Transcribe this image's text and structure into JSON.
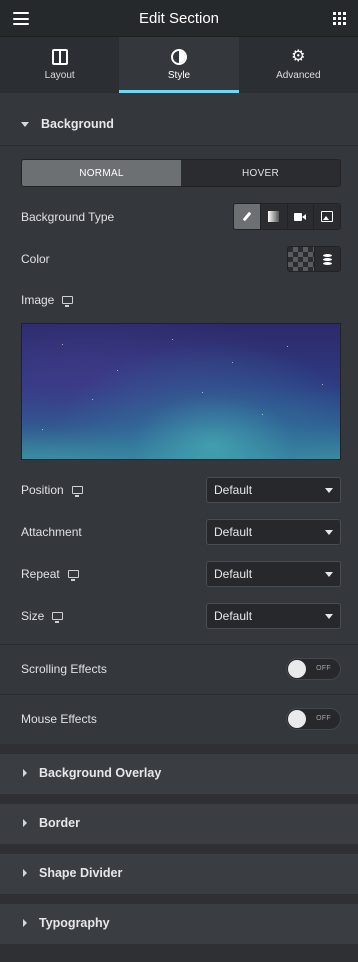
{
  "header": {
    "title": "Edit Section",
    "menu_icon": "hamburger-icon",
    "apps_icon": "grid-icon"
  },
  "tabs": [
    {
      "label": "Layout",
      "icon": "layout-icon"
    },
    {
      "label": "Style",
      "icon": "contrast-icon",
      "active": true
    },
    {
      "label": "Advanced",
      "icon": "gear-icon"
    }
  ],
  "background_section": {
    "title": "Background",
    "state_normal": "NORMAL",
    "state_hover": "HOVER",
    "background_type_label": "Background Type",
    "color_label": "Color",
    "image_label": "Image",
    "position_label": "Position",
    "position_value": "Default",
    "attachment_label": "Attachment",
    "attachment_value": "Default",
    "repeat_label": "Repeat",
    "repeat_value": "Default",
    "size_label": "Size",
    "size_value": "Default"
  },
  "effects": {
    "scrolling_label": "Scrolling Effects",
    "scrolling_state": "OFF",
    "mouse_label": "Mouse Effects",
    "mouse_state": "OFF"
  },
  "collapsed_sections": {
    "overlay": "Background Overlay",
    "border": "Border",
    "shape_divider": "Shape Divider",
    "typography": "Typography"
  },
  "colors": {
    "accent": "#71d7f7",
    "panel": "#34373c",
    "header": "#26292c"
  }
}
